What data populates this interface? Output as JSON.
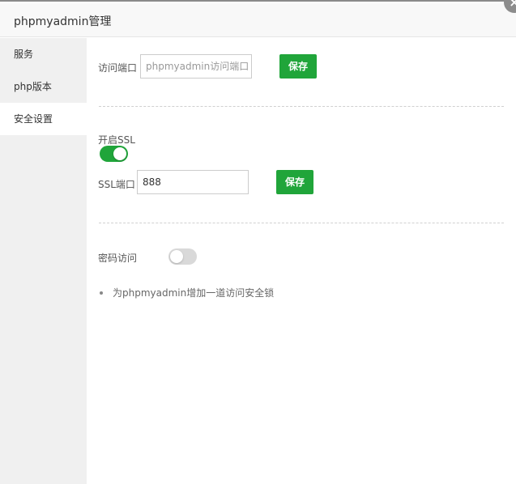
{
  "window": {
    "title": "phpmyadmin管理",
    "close_glyph": "×"
  },
  "sidebar": {
    "items": [
      {
        "label": "服务"
      },
      {
        "label": "php版本"
      },
      {
        "label": "安全设置"
      }
    ],
    "active_index": 2
  },
  "access_port": {
    "label": "访问端口",
    "value": "",
    "placeholder": "phpmyadmin访问端口",
    "save_label": "保存"
  },
  "ssl": {
    "toggle_label": "开启SSL",
    "enabled": true,
    "port_label": "SSL端口",
    "port_value": "888",
    "save_label": "保存"
  },
  "password_access": {
    "label": "密码访问",
    "enabled": false
  },
  "tips": [
    "为phpmyadmin增加一道访问安全锁"
  ],
  "colors": {
    "accent": "#20a53a",
    "toggle_off": "#d9d9d9",
    "sidebar_bg": "#f0f0f0"
  }
}
